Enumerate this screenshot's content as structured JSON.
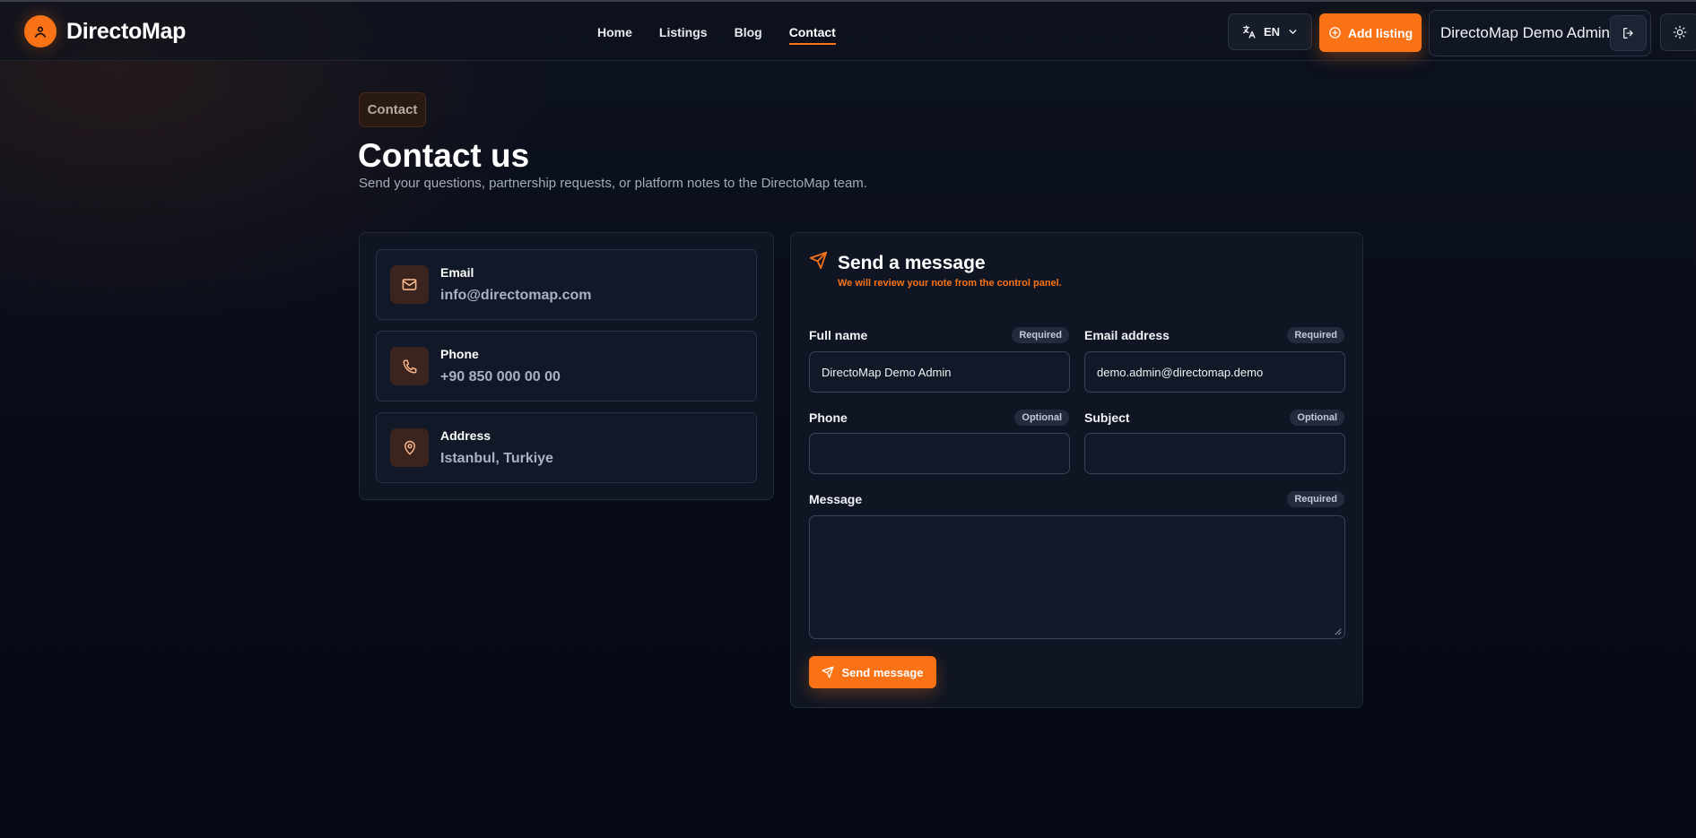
{
  "header": {
    "brand": "DirectoMap",
    "nav": [
      {
        "label": "Home",
        "active": false
      },
      {
        "label": "Listings",
        "active": false
      },
      {
        "label": "Blog",
        "active": false
      },
      {
        "label": "Contact",
        "active": true
      }
    ],
    "language": "EN",
    "add_listing": "Add listing",
    "user_name": "DirectoMap Demo Admin"
  },
  "page": {
    "breadcrumb": "Contact",
    "title": "Contact us",
    "subtitle": "Send your questions, partnership requests, or platform notes to the DirectoMap team."
  },
  "contact_info": [
    {
      "label": "Email",
      "value": "info@directomap.com",
      "icon": "mail-icon"
    },
    {
      "label": "Phone",
      "value": "+90 850 000 00 00",
      "icon": "phone-icon"
    },
    {
      "label": "Address",
      "value": "Istanbul, Turkiye",
      "icon": "map-pin-icon"
    }
  ],
  "form": {
    "title": "Send a message",
    "note": "We will review your note from the control panel.",
    "fields": {
      "full_name": {
        "label": "Full name",
        "badge": "Required",
        "value": "DirectoMap Demo Admin"
      },
      "email": {
        "label": "Email address",
        "badge": "Required",
        "value": "demo.admin@directomap.demo"
      },
      "phone": {
        "label": "Phone",
        "badge": "Optional",
        "value": ""
      },
      "subject": {
        "label": "Subject",
        "badge": "Optional",
        "value": ""
      },
      "message": {
        "label": "Message",
        "badge": "Required",
        "value": ""
      }
    },
    "submit": "Send message"
  },
  "colors": {
    "accent": "#f97316",
    "background": "#070b17",
    "card": "#0f1523"
  }
}
